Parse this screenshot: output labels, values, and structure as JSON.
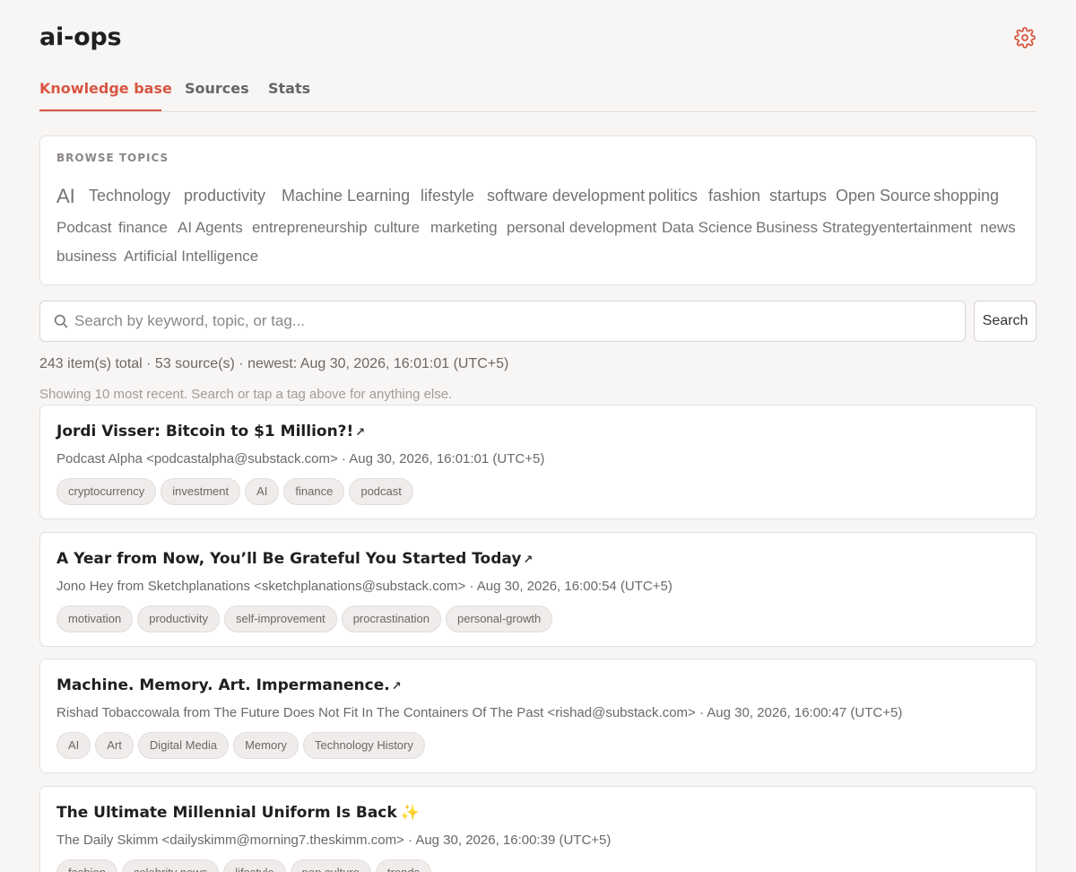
{
  "app": {
    "title": "ai-ops",
    "settings_icon": "gear-icon",
    "accent_color": "#d85642"
  },
  "tabs": [
    {
      "label": "Knowledge base",
      "active": true
    },
    {
      "label": "Sources",
      "active": false
    },
    {
      "label": "Stats",
      "active": false
    }
  ],
  "topics": {
    "heading": "BROWSE TOPICS",
    "items": [
      "AI",
      "Technology",
      "productivity",
      "Machine Learning",
      "lifestyle",
      "software development",
      "politics",
      "fashion",
      "startups",
      "Open Source",
      "shopping",
      "Podcast",
      "finance",
      "AI Agents",
      "entrepreneurship",
      "culture",
      "marketing",
      "personal development",
      "Data Science",
      "Business Strategy",
      "entertainment",
      "news",
      "business",
      "Artificial Intelligence"
    ]
  },
  "search": {
    "placeholder": "Search by keyword, topic, or tag...",
    "value": "",
    "button_label": "Search",
    "icon": "search-icon"
  },
  "summary": "243 item(s) total · 53 source(s) · newest: Aug 30, 2026, 16:01:01 (UTC+5)",
  "hint": "Showing 10 most recent. Search or tap a tag above for anything else.",
  "items": [
    {
      "title": "Jordi Visser: Bitcoin to $1 Million?!",
      "link_icon": "↗",
      "meta": "Podcast Alpha <podcastalpha@substack.com> · Aug 30, 2026, 16:01:01 (UTC+5)",
      "tags": [
        "cryptocurrency",
        "investment",
        "AI",
        "finance",
        "podcast"
      ]
    },
    {
      "title": "A Year from Now, You’ll Be Grateful You Started Today",
      "link_icon": "↗",
      "meta": "Jono Hey from Sketchplanations <sketchplanations@substack.com> · Aug 30, 2026, 16:00:54 (UTC+5)",
      "tags": [
        "motivation",
        "productivity",
        "self-improvement",
        "procrastination",
        "personal-growth"
      ]
    },
    {
      "title": "Machine. Memory. Art. Impermanence.",
      "link_icon": "↗",
      "meta": "Rishad Tobaccowala from The Future Does Not Fit In The Containers Of The Past <rishad@substack.com> · Aug 30, 2026, 16:00:47 (UTC+5)",
      "tags": [
        "AI",
        "Art",
        "Digital Media",
        "Memory",
        "Technology History"
      ]
    },
    {
      "title": "The Ultimate Millennial Uniform Is Back",
      "link_icon": "✨",
      "meta": "The Daily Skimm <dailyskimm@morning7.theskimm.com> · Aug 30, 2026, 16:00:39 (UTC+5)",
      "tags": [
        "fashion",
        "celebrity news",
        "lifestyle",
        "pop culture",
        "trends"
      ]
    }
  ]
}
